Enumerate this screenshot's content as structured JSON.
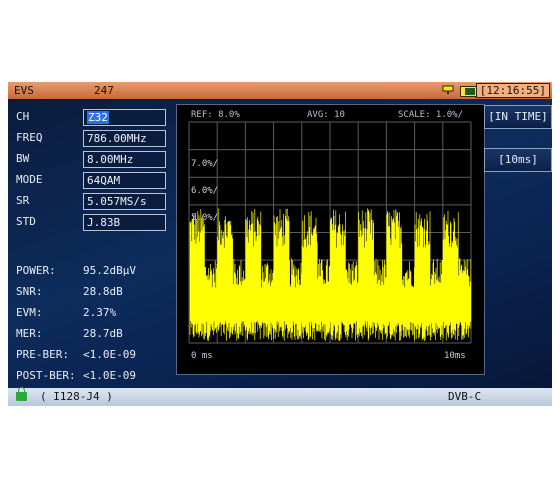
{
  "titlebar": {
    "mode": "EVS",
    "channel_number": "247",
    "clock": "[12:16:55]",
    "icons": [
      "signal-icon",
      "battery-icon"
    ]
  },
  "params": [
    {
      "label": "CH",
      "value": "Z32",
      "selected": true
    },
    {
      "label": "FREQ",
      "value": "786.00MHz"
    },
    {
      "label": "BW",
      "value": "8.00MHz"
    },
    {
      "label": "MODE",
      "value": "64QAM"
    },
    {
      "label": "SR",
      "value": "5.057MS/s"
    },
    {
      "label": "STD",
      "value": "J.83B"
    }
  ],
  "measurements": [
    {
      "label": "POWER:",
      "value": "95.2dBµV"
    },
    {
      "label": "SNR:",
      "value": "28.8dB"
    },
    {
      "label": "EVM:",
      "value": "2.37%"
    },
    {
      "label": "MER:",
      "value": "28.7dB"
    },
    {
      "label": "PRE-BER:",
      "value": "<1.0E-09"
    },
    {
      "label": "POST-BER:",
      "value": "<1.0E-09"
    }
  ],
  "plot": {
    "ref": "REF: 8.0%",
    "avg": "AVG: 10",
    "scale": "SCALE: 1.0%/",
    "grid_labels": [
      "7.0%/",
      "6.0%/",
      "5.0%/"
    ],
    "x_start": "0 ms",
    "x_end": "10ms",
    "trace_color": "#ffff00"
  },
  "side_buttons": {
    "in_time": "[IN TIME]",
    "span": "[10ms]"
  },
  "statusbar": {
    "constellation": "( I128-J4 )",
    "standard": "DVB-C"
  },
  "colors": {
    "title_bar": "#d87a48",
    "selection": "#2d6fe8",
    "trace": "#ffff00"
  }
}
